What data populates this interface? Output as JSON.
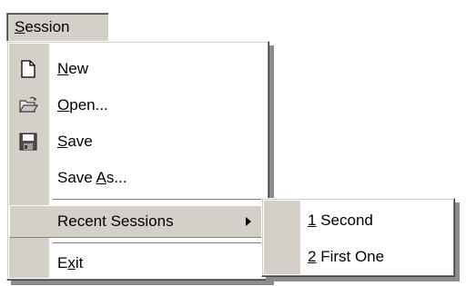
{
  "menubar": {
    "session_prefix": "S",
    "session_rest": "ession"
  },
  "menu": {
    "items": [
      {
        "name": "new",
        "icon": "new-document-icon",
        "underline": "N",
        "rest": "ew"
      },
      {
        "name": "open",
        "icon": "open-folder-icon",
        "underline": "O",
        "rest": "pen..."
      },
      {
        "name": "save",
        "icon": "floppy-disk-icon",
        "underline": "S",
        "rest": "ave"
      },
      {
        "name": "save-as",
        "before": "Save ",
        "underline": "A",
        "rest": "s..."
      },
      {
        "name": "recent-sessions",
        "label": "Recent Sessions",
        "has_submenu": true
      },
      {
        "name": "exit",
        "before": "E",
        "underline": "x",
        "rest": "it"
      }
    ]
  },
  "submenu": {
    "items": [
      {
        "underline": "1",
        "rest": " Second"
      },
      {
        "underline": "2",
        "rest": " First One"
      }
    ]
  },
  "colors": {
    "face": "#d4d0c8",
    "shadow": "#808080",
    "menu_bg": "#ffffff"
  }
}
